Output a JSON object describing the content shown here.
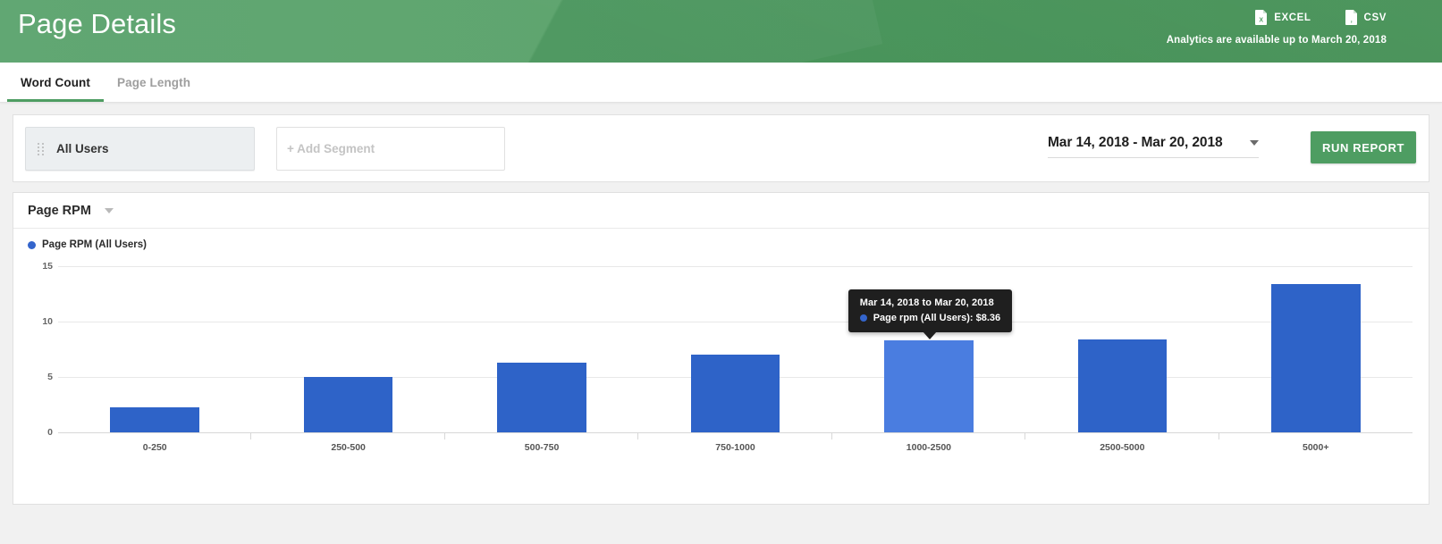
{
  "header": {
    "title": "Page Details",
    "exports": [
      {
        "label": "EXCEL",
        "icon": "excel-file-icon"
      },
      {
        "label": "CSV",
        "icon": "csv-file-icon"
      }
    ],
    "availability_note": "Analytics are available up to March 20, 2018",
    "background_color": "#4e9d62"
  },
  "tabs": [
    {
      "label": "Word Count",
      "active": true
    },
    {
      "label": "Page Length",
      "active": false
    }
  ],
  "segment_bar": {
    "segment_chip": "All Users",
    "add_segment": "+ Add Segment",
    "date_range": "Mar 14, 2018 - Mar 20, 2018",
    "run_report": "RUN REPORT",
    "run_report_color": "#4e9d62"
  },
  "chart_panel": {
    "metric_selector": "Page RPM",
    "legend_label": "Page RPM (All Users)",
    "legend_color": "#3465cc"
  },
  "tooltip": {
    "visible": true,
    "title": "Mar 14, 2018 to Mar 20, 2018",
    "series_label": "Page rpm (All Users):",
    "value": "$8.36",
    "dot_color": "#3465cc",
    "anchor_category": "1000-2500"
  },
  "chart_data": {
    "type": "bar",
    "title": "Page RPM",
    "xlabel": "",
    "ylabel": "",
    "categories": [
      "0-250",
      "250-500",
      "500-750",
      "750-1000",
      "1000-2500",
      "2500-5000",
      "5000+"
    ],
    "values": [
      2.3,
      5.0,
      6.3,
      7.0,
      8.36,
      8.4,
      13.4
    ],
    "series": [
      {
        "name": "Page RPM (All Users)",
        "values": [
          2.3,
          5.0,
          6.3,
          7.0,
          8.36,
          8.4,
          13.4
        ]
      }
    ],
    "yticks": [
      0,
      5,
      10,
      15
    ],
    "ylim": [
      0,
      16
    ],
    "grid": true,
    "legend_position": "top-left",
    "bar_color": "#2e63c8",
    "highlight_color": "#4a7de0",
    "highlighted_index": 4
  }
}
